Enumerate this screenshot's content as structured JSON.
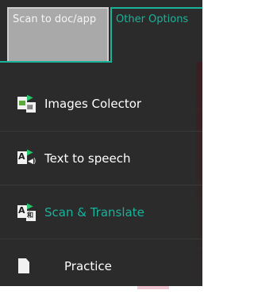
{
  "tabs": {
    "scan": {
      "label": "Scan to doc/app"
    },
    "other": {
      "label": "Other Options"
    }
  },
  "menu": {
    "items": [
      {
        "label": "Images Colector",
        "icon": "images-collector-icon"
      },
      {
        "label": "Text to speech",
        "icon": "text-to-speech-icon"
      },
      {
        "label": "Scan & Translate",
        "icon": "scan-translate-icon",
        "selected": true
      },
      {
        "label": "Practice",
        "icon": "document-icon"
      }
    ]
  },
  "colors": {
    "accent": "#19b39a",
    "panel": "#2b2b2b",
    "tab_inactive": "#a9a9a9"
  }
}
